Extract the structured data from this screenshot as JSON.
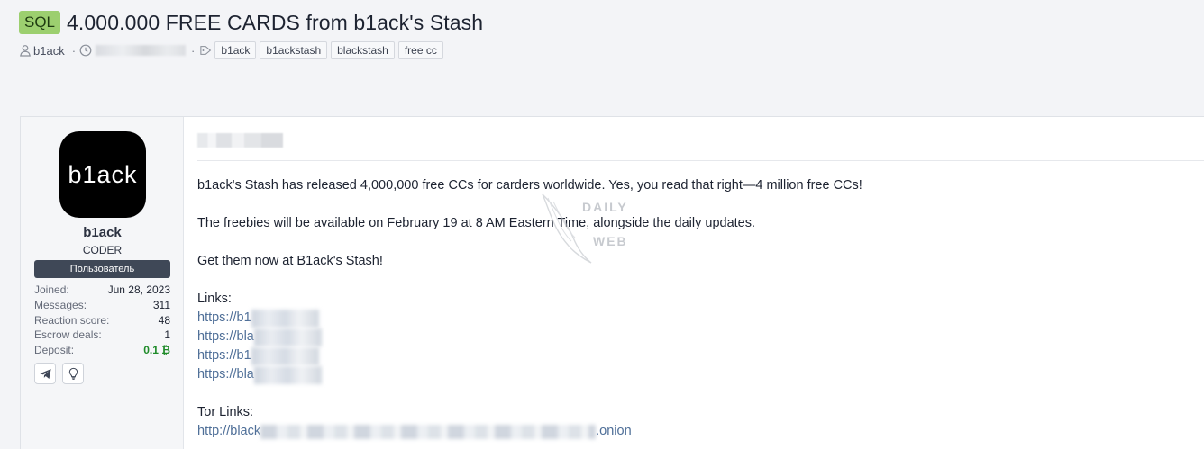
{
  "thread": {
    "prefix": "SQL",
    "title": "4.000.000 FREE CARDS from b1ack's Stash",
    "author": "b1ack",
    "tags": [
      "b1ack",
      "b1ackstash",
      "blackstash",
      "free cc"
    ]
  },
  "user": {
    "avatar_text": "b1ack",
    "name": "b1ack",
    "title": "CODER",
    "banner": "Пользователь",
    "stats": [
      {
        "label": "Joined:",
        "value": "Jun 28, 2023"
      },
      {
        "label": "Messages:",
        "value": "311"
      },
      {
        "label": "Reaction score:",
        "value": "48"
      },
      {
        "label": "Escrow deals:",
        "value": "1"
      },
      {
        "label": "Deposit:",
        "value": "0.1 ₿"
      }
    ],
    "contact_icons": [
      "telegram-icon",
      "lightbulb-icon"
    ]
  },
  "post": {
    "line1": "b1ack's Stash has released 4,000,000 free CCs for carders worldwide. Yes, you read that right—4 million free CCs!",
    "line2": "The freebies will be available on February 19 at 8 AM Eastern Time, alongside the daily updates.",
    "line3": "Get them now at B1ack's Stash!",
    "links_heading": "Links:",
    "links": [
      "https://b1",
      "https://bla",
      "https://b1",
      "https://bla"
    ],
    "tor_heading": "Tor Links:",
    "tor_link_start": "http://black",
    "tor_link_end": ".onion"
  },
  "watermark": {
    "line1": "DAILY",
    "line2": "WEB"
  },
  "colors": {
    "prefix_bg": "#9ccf6f",
    "banner_bg": "#3f4857",
    "link": "#4f6f98",
    "deposit": "#1f8b2a"
  }
}
